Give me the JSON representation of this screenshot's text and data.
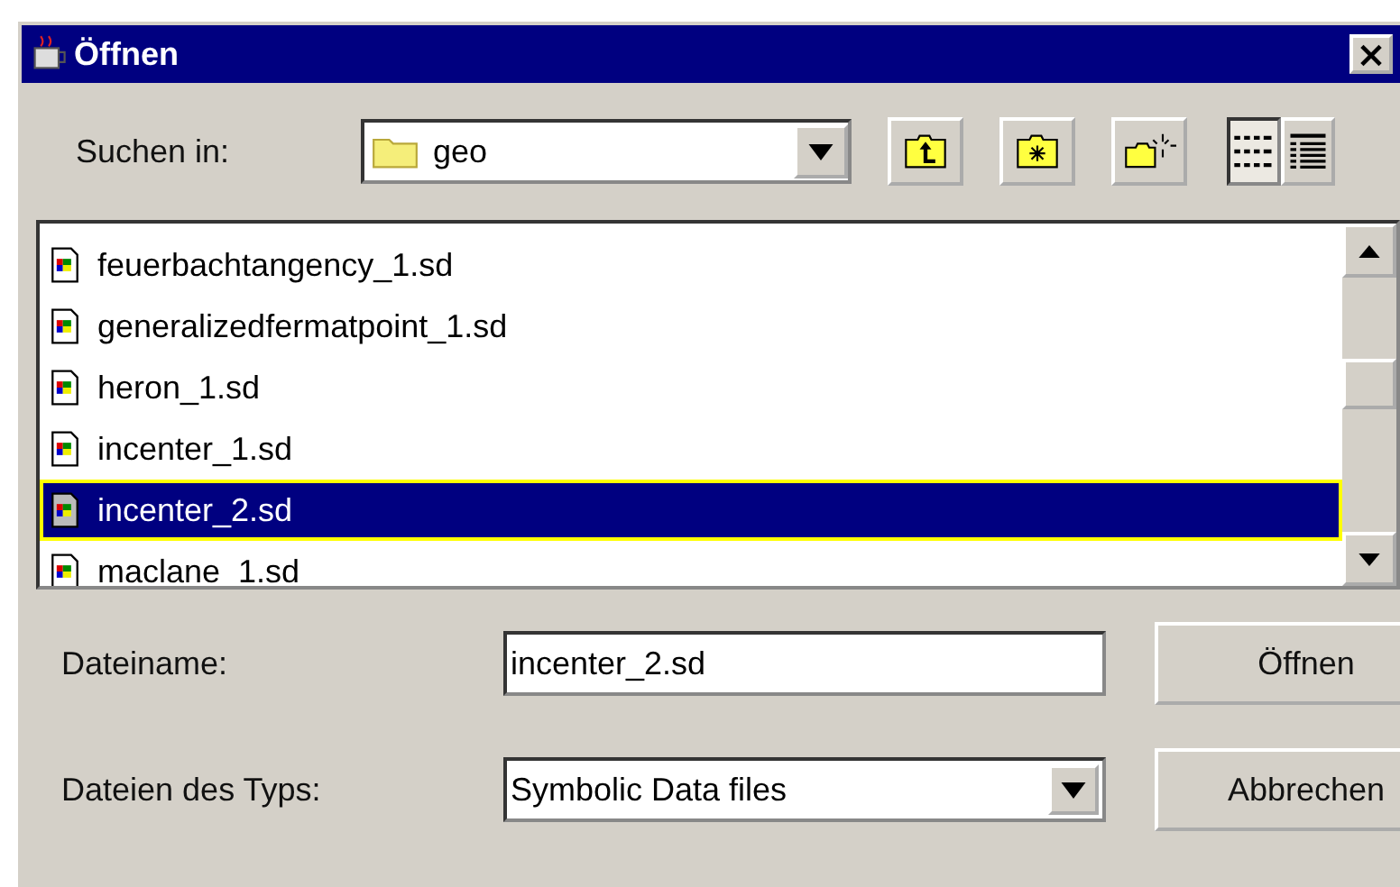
{
  "window": {
    "title": "Öffnen",
    "close_glyph": "×"
  },
  "look_in": {
    "label": "Suchen in:",
    "value": "geo"
  },
  "view_toggles": [
    {
      "kind": "list",
      "selected": true
    },
    {
      "kind": "details",
      "selected": false
    }
  ],
  "files": [
    {
      "name": "feuerbachtangency_1.sd",
      "selected": false
    },
    {
      "name": "generalizedfermatpoint_1.sd",
      "selected": false
    },
    {
      "name": "heron_1.sd",
      "selected": false
    },
    {
      "name": "incenter_1.sd",
      "selected": false
    },
    {
      "name": "incenter_2.sd",
      "selected": true
    },
    {
      "name": "maclane_1.sd",
      "selected": false
    }
  ],
  "file_name": {
    "label": "Dateiname:",
    "value": "incenter_2.sd"
  },
  "file_type": {
    "label": "Dateien des Typs:",
    "value": "Symbolic Data files"
  },
  "buttons": [
    "Öffnen",
    "Abbrechen"
  ]
}
